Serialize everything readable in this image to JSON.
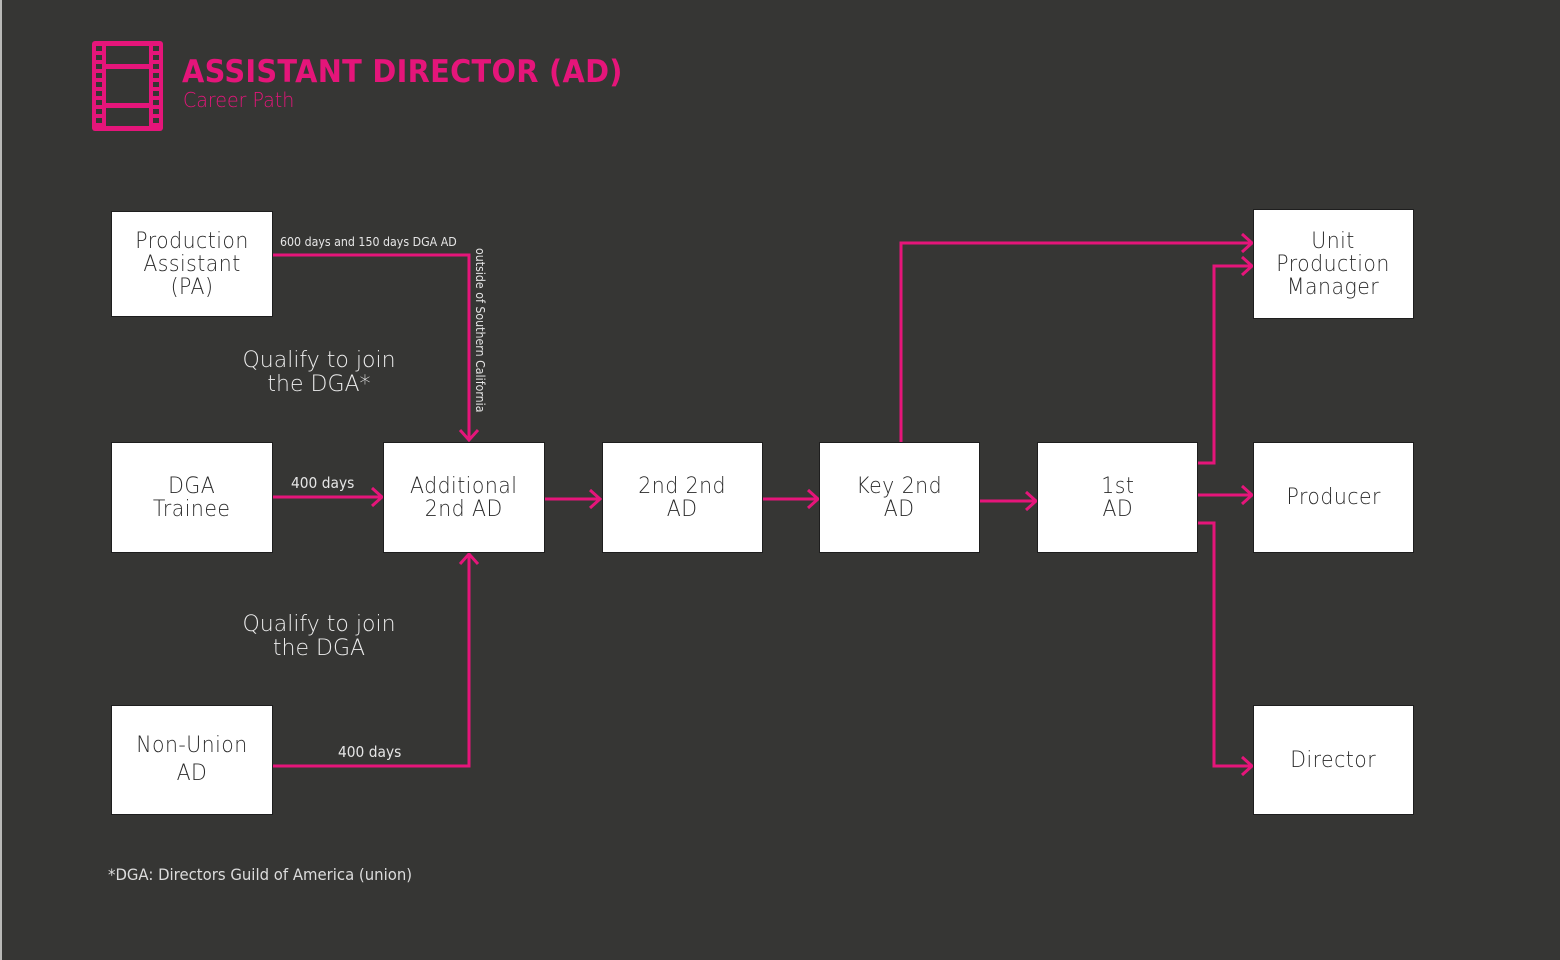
{
  "header": {
    "icon": "film-strip-icon",
    "title": "ASSISTANT DIRECTOR (AD)",
    "subtitle": "Career Path"
  },
  "colors": {
    "accent": "#e5157a",
    "background": "#363634",
    "node_fill": "#ffffff",
    "node_text": "#2a2a2a",
    "label_text": "#e6e6e6"
  },
  "nodes": {
    "pa": "Production\nAssistant\n(PA)",
    "dga_trainee": "DGA\nTrainee",
    "non_union_ad": "Non-Union\nAD",
    "additional_2nd_ad": "Additional\n2nd AD",
    "second_second_ad": "2nd 2nd\nAD",
    "key_2nd_ad": "Key 2nd\nAD",
    "first_ad": "1st\nAD",
    "upm": "Unit\nProduction\nManager",
    "producer": "Producer",
    "director": "Director"
  },
  "edges": [
    {
      "from": "pa",
      "to": "additional_2nd_ad",
      "label": "600 days and 150 days DGA AD",
      "label2": "outside of Southern California"
    },
    {
      "from": "dga_trainee",
      "to": "additional_2nd_ad",
      "label": "400 days"
    },
    {
      "from": "non_union_ad",
      "to": "additional_2nd_ad",
      "label": "400 days"
    },
    {
      "from": "additional_2nd_ad",
      "to": "second_second_ad",
      "label": ""
    },
    {
      "from": "second_second_ad",
      "to": "key_2nd_ad",
      "label": ""
    },
    {
      "from": "key_2nd_ad",
      "to": "first_ad",
      "label": ""
    },
    {
      "from": "key_2nd_ad",
      "to": "upm",
      "label": ""
    },
    {
      "from": "first_ad",
      "to": "upm",
      "label": ""
    },
    {
      "from": "first_ad",
      "to": "producer",
      "label": ""
    },
    {
      "from": "first_ad",
      "to": "director",
      "label": ""
    }
  ],
  "labels": {
    "pa_edge": "600 days and 150 days DGA AD",
    "pa_edge_vertical": "outside of Southern California",
    "trainee_edge": "400 days",
    "nonunion_edge": "400 days",
    "qualify_top": "Qualify to join\nthe DGA*",
    "qualify_bottom": "Qualify to join\nthe DGA"
  },
  "footnote": "*DGA: Directors Guild of America (union)"
}
